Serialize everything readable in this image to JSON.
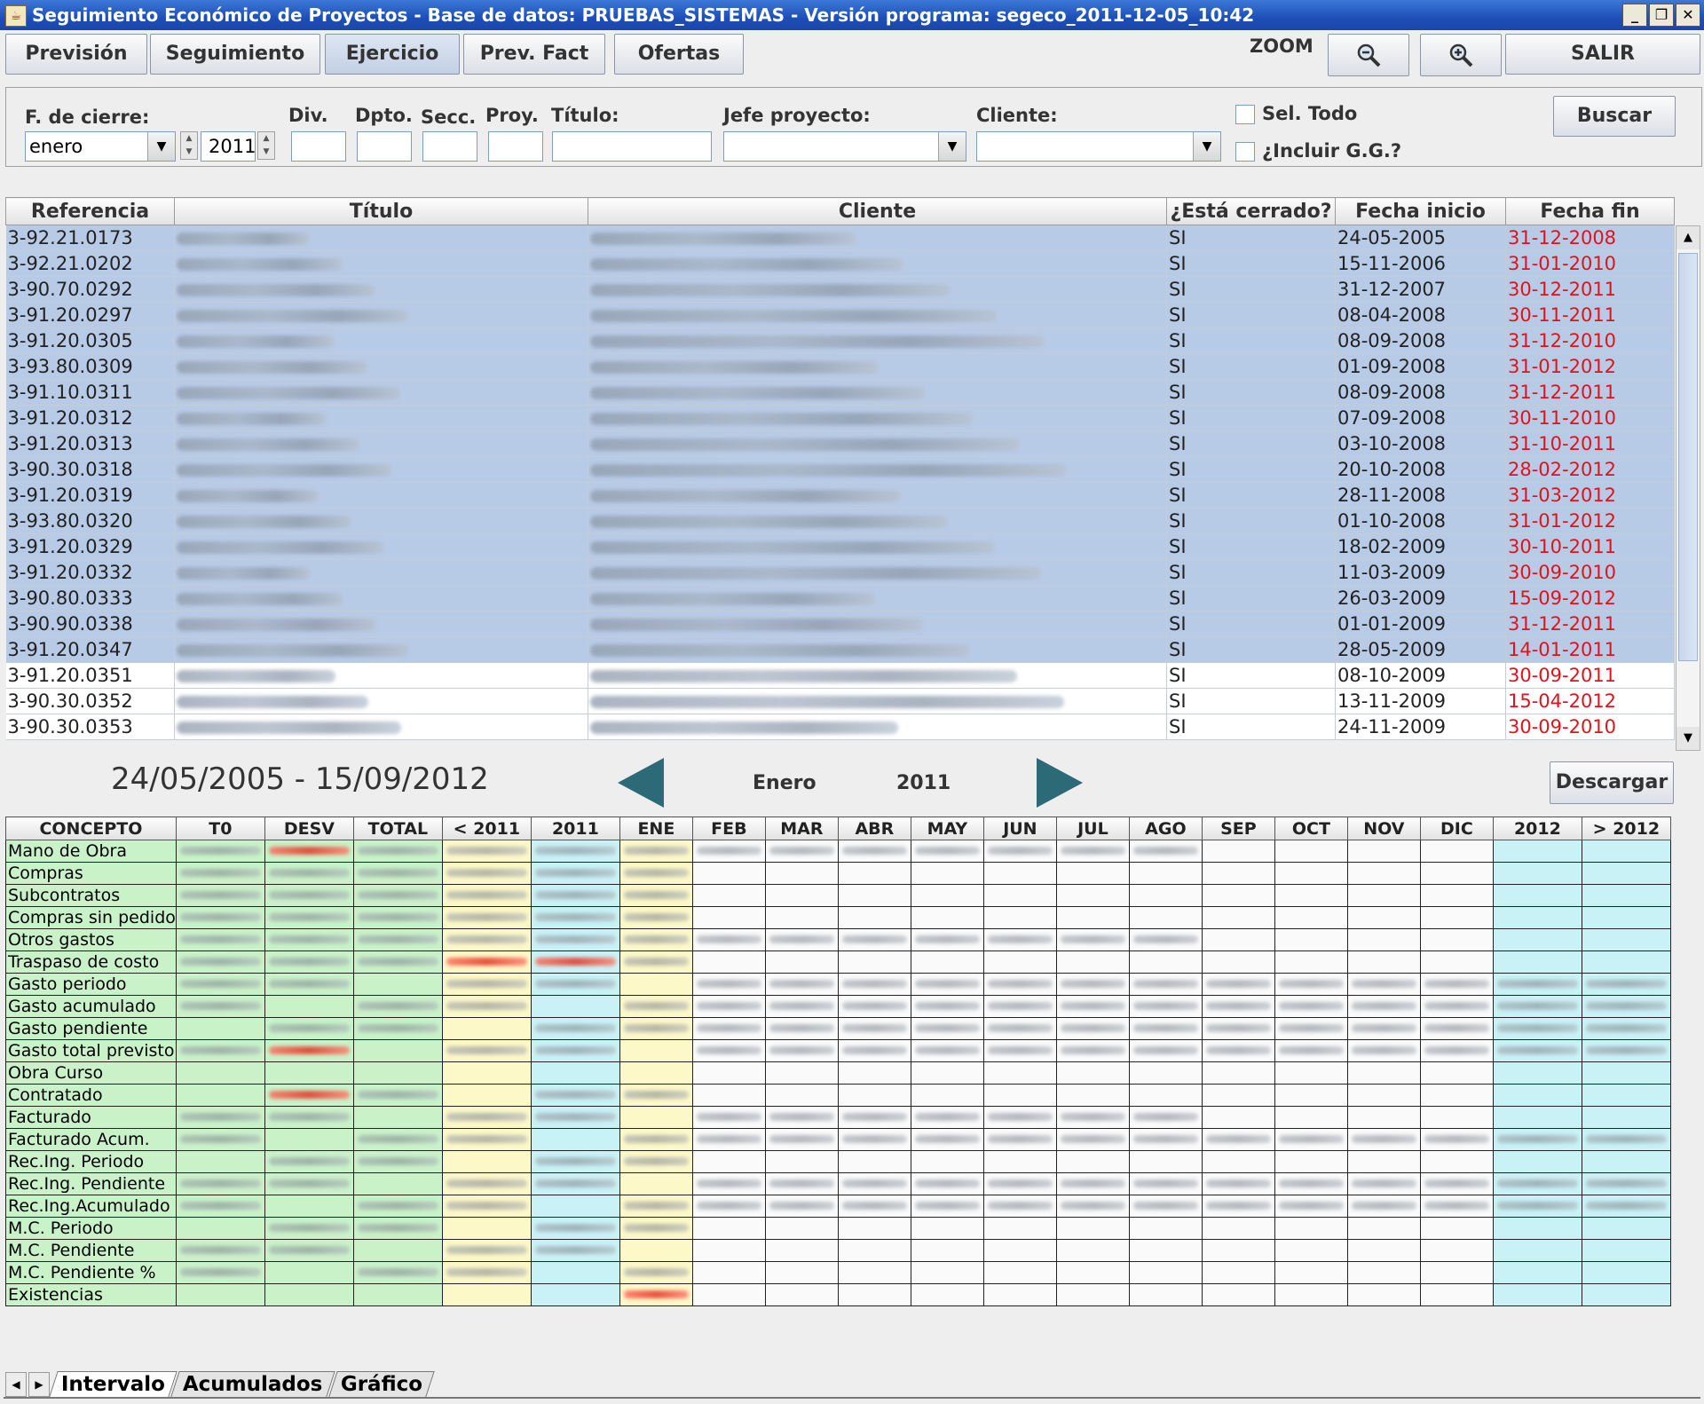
{
  "window": {
    "title": "Seguimiento Económico de Proyectos - Base de datos: PRUEBAS_SISTEMAS - Versión programa: segeco_2011-12-05_10:42",
    "controls": [
      "_",
      "❐",
      "✕"
    ]
  },
  "toolbar": {
    "buttons": [
      "Previsión",
      "Seguimiento",
      "Ejercicio",
      "Prev. Fact",
      "Ofertas"
    ],
    "active": "Ejercicio",
    "zoom_label": "ZOOM",
    "zoom_out_icon": "zoom-out-icon",
    "zoom_in_icon": "zoom-in-icon",
    "exit_label": "SALIR"
  },
  "filters": {
    "cierre_label": "F. de cierre:",
    "month_value": "enero",
    "year_value": "2011",
    "div_label": "Div.",
    "dpto_label": "Dpto.",
    "secc_label": "Secc.",
    "proy_label": "Proy.",
    "titulo_label": "Título:",
    "jefe_label": "Jefe proyecto:",
    "cliente_label": "Cliente:",
    "sel_todo_label": "Sel. Todo",
    "incluir_label": "¿Incluir G.G.?",
    "buscar_label": "Buscar"
  },
  "projects": {
    "columns": [
      "Referencia",
      "Título",
      "Cliente",
      "¿Está cerrado?",
      "Fecha inicio",
      "Fecha fin"
    ],
    "rows": [
      {
        "ref": "3-92.21.0173",
        "closed": "SI",
        "start": "24-05-2005",
        "end": "31-12-2008",
        "selected": true
      },
      {
        "ref": "3-92.21.0202",
        "closed": "SI",
        "start": "15-11-2006",
        "end": "31-01-2010",
        "selected": true
      },
      {
        "ref": "3-90.70.0292",
        "closed": "SI",
        "start": "31-12-2007",
        "end": "30-12-2011",
        "selected": true
      },
      {
        "ref": "3-91.20.0297",
        "closed": "SI",
        "start": "08-04-2008",
        "end": "30-11-2011",
        "selected": true
      },
      {
        "ref": "3-91.20.0305",
        "closed": "SI",
        "start": "08-09-2008",
        "end": "31-12-2010",
        "selected": true
      },
      {
        "ref": "3-93.80.0309",
        "closed": "SI",
        "start": "01-09-2008",
        "end": "31-01-2012",
        "selected": true
      },
      {
        "ref": "3-91.10.0311",
        "closed": "SI",
        "start": "08-09-2008",
        "end": "31-12-2011",
        "selected": true
      },
      {
        "ref": "3-91.20.0312",
        "closed": "SI",
        "start": "07-09-2008",
        "end": "30-11-2010",
        "selected": true
      },
      {
        "ref": "3-91.20.0313",
        "closed": "SI",
        "start": "03-10-2008",
        "end": "31-10-2011",
        "selected": true
      },
      {
        "ref": "3-90.30.0318",
        "closed": "SI",
        "start": "20-10-2008",
        "end": "28-02-2012",
        "selected": true
      },
      {
        "ref": "3-91.20.0319",
        "closed": "SI",
        "start": "28-11-2008",
        "end": "31-03-2012",
        "selected": true
      },
      {
        "ref": "3-93.80.0320",
        "closed": "SI",
        "start": "01-10-2008",
        "end": "31-01-2012",
        "selected": true
      },
      {
        "ref": "3-91.20.0329",
        "closed": "SI",
        "start": "18-02-2009",
        "end": "30-10-2011",
        "selected": true
      },
      {
        "ref": "3-91.20.0332",
        "closed": "SI",
        "start": "11-03-2009",
        "end": "30-09-2010",
        "selected": true
      },
      {
        "ref": "3-90.80.0333",
        "closed": "SI",
        "start": "26-03-2009",
        "end": "15-09-2012",
        "selected": true
      },
      {
        "ref": "3-90.90.0338",
        "closed": "SI",
        "start": "01-01-2009",
        "end": "31-12-2011",
        "selected": true
      },
      {
        "ref": "3-91.20.0347",
        "closed": "SI",
        "start": "28-05-2009",
        "end": "14-01-2011",
        "selected": true
      },
      {
        "ref": "3-91.20.0351",
        "closed": "SI",
        "start": "08-10-2009",
        "end": "30-09-2011",
        "selected": false
      },
      {
        "ref": "3-90.30.0352",
        "closed": "SI",
        "start": "13-11-2009",
        "end": "15-04-2012",
        "selected": false
      },
      {
        "ref": "3-90.30.0353",
        "closed": "SI",
        "start": "24-11-2009",
        "end": "30-09-2010",
        "selected": false
      }
    ],
    "end_date_color": "#e0131b",
    "selection_color": "#b8cbe6"
  },
  "navigation": {
    "range": "24/05/2005 - 15/09/2012",
    "month": "Enero",
    "year": "2011",
    "download_label": "Descargar"
  },
  "concepts": {
    "columns": [
      "CONCEPTO",
      "T0",
      "DESV",
      "TOTAL",
      "< 2011",
      "2011",
      "ENE",
      "FEB",
      "MAR",
      "ABR",
      "MAY",
      "JUN",
      "JUL",
      "AGO",
      "SEP",
      "OCT",
      "NOV",
      "DIC",
      "2012",
      "> 2012"
    ],
    "rows": [
      "Mano de Obra",
      "Compras",
      "Subcontratos",
      "Compras sin pedido",
      "Otros gastos",
      "Traspaso de costo",
      "Gasto periodo",
      "Gasto acumulado",
      "Gasto pendiente",
      "Gasto total previsto",
      "Obra Curso",
      "Contratado",
      "Facturado",
      "Facturado Acum.",
      "Rec.Ing. Periodo",
      "Rec.Ing. Pendiente",
      "Rec.Ing.Acumulado",
      "M.C. Periodo",
      "M.C. Pendiente",
      "M.C. Pendiente %",
      "Existencias"
    ],
    "colors": {
      "concept": "#c9f2c9",
      "lt2011": "#fdf8c8",
      "y2011": "#c9f2f6",
      "ene": "#fdf8c8",
      "y2012": "#c9f2f6"
    }
  },
  "tabs": {
    "items": [
      "Intervalo",
      "Acumulados",
      "Gráfico"
    ],
    "active": "Intervalo"
  }
}
